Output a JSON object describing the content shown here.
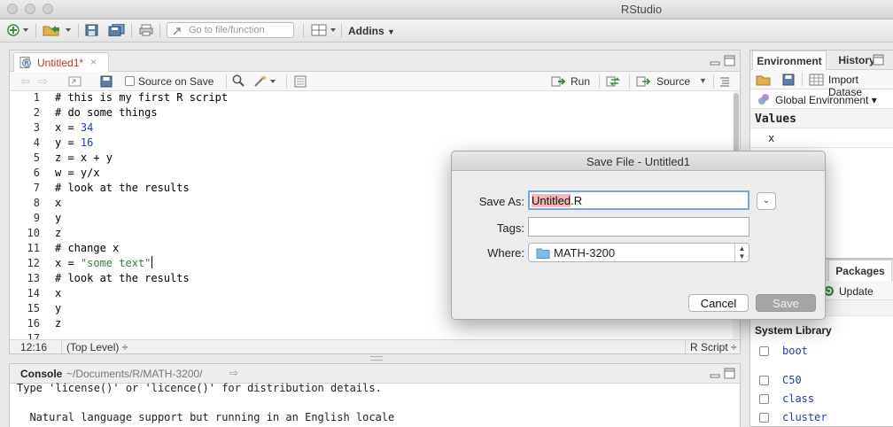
{
  "window": {
    "title": "RStudio"
  },
  "main_toolbar": {
    "goto_placeholder": "Go to file/function",
    "addins_label": "Addins"
  },
  "editor": {
    "tab_label": "Untitled1*",
    "tab_close": "×",
    "source_on_save_label": "Source on Save",
    "run_label": "Run",
    "source_label": "Source",
    "lines": [
      {
        "n": "1",
        "text": "# this is my first R script"
      },
      {
        "n": "2",
        "text": "# do some things"
      },
      {
        "n": "3",
        "text": "x = 34"
      },
      {
        "n": "4",
        "text": "y = 16"
      },
      {
        "n": "5",
        "text": "z = x + y"
      },
      {
        "n": "6",
        "text": "w = y/x"
      },
      {
        "n": "7",
        "text": "# look at the results"
      },
      {
        "n": "8",
        "text": "x"
      },
      {
        "n": "9",
        "text": "y"
      },
      {
        "n": "10",
        "text": "z"
      },
      {
        "n": "11",
        "text": "# change x"
      },
      {
        "n": "12",
        "text": "x = \"some text\""
      },
      {
        "n": "13",
        "text": "# look at the results"
      },
      {
        "n": "14",
        "text": "x"
      },
      {
        "n": "15",
        "text": "y"
      },
      {
        "n": "16",
        "text": "z"
      },
      {
        "n": "17",
        "text": ""
      }
    ],
    "status": {
      "position": "12:16",
      "scope": "(Top Level) ÷",
      "filetype": "R Script ÷"
    }
  },
  "console": {
    "title": "Console",
    "path": "~/Documents/R/MATH-3200/",
    "lines": [
      "Type 'license()' or 'licence()' for distribution details.",
      "",
      "  Natural language support but running in an English locale"
    ]
  },
  "right_top": {
    "tabs": [
      "Environment",
      "History"
    ],
    "import_label": "Import Datase",
    "global_env_label": "Global Environment ▾",
    "values_heading": "Values",
    "values": [
      "x"
    ]
  },
  "right_bottom": {
    "packages_tab": "Packages",
    "update_label": "Update",
    "system_library_label": "System Library",
    "packages": [
      "boot",
      "C50",
      "class",
      "cluster"
    ]
  },
  "dialog": {
    "title": "Save File - Untitled1",
    "save_as_label": "Save As:",
    "save_as_selected": "Untitled",
    "save_as_rest": ".R",
    "tags_label": "Tags:",
    "tags_value": "",
    "where_label": "Where:",
    "where_value": "MATH-3200",
    "cancel_label": "Cancel",
    "save_label": "Save"
  },
  "colors": {
    "comment": "#3d7a3d",
    "number": "#1f3fa8",
    "tab_modified": "#c0312b",
    "selection": "#f7b7b7"
  }
}
